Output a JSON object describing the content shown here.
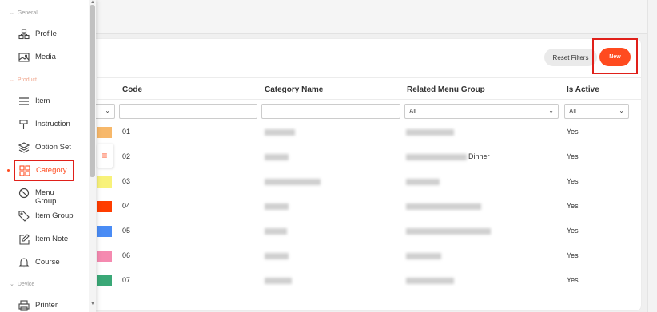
{
  "sidebar": {
    "sections": [
      {
        "label": "General"
      },
      {
        "label": "Product"
      },
      {
        "label": "Device"
      }
    ],
    "items": [
      {
        "label": "Profile",
        "icon": "profile-icon"
      },
      {
        "label": "Media",
        "icon": "image-icon"
      },
      {
        "label": "Item",
        "icon": "list-icon"
      },
      {
        "label": "Instruction",
        "icon": "instruction-icon"
      },
      {
        "label": "Option Set",
        "icon": "layers-icon"
      },
      {
        "label": "Category",
        "icon": "grid-icon",
        "active": true
      },
      {
        "label": "Menu Group",
        "icon": "no-entry-icon"
      },
      {
        "label": "Item Group",
        "icon": "tag-icon"
      },
      {
        "label": "Item Note",
        "icon": "edit-icon"
      },
      {
        "label": "Course",
        "icon": "bell-icon"
      },
      {
        "label": "Printer",
        "icon": "printer-icon"
      }
    ]
  },
  "toolbar": {
    "reset_label": "Reset Filters",
    "new_label": "New"
  },
  "table": {
    "headers": {
      "code": "Code",
      "category_name": "Category Name",
      "related_menu_group": "Related Menu Group",
      "is_active": "Is Active"
    },
    "filters": {
      "related_menu_group": "All",
      "is_active": "All"
    },
    "rows": [
      {
        "color": "#f7b86a",
        "code": "01",
        "menu_group": "",
        "active": "Yes"
      },
      {
        "color": "#ffffff",
        "code": "02",
        "menu_group": "Dinner",
        "active": "Yes"
      },
      {
        "color": "#f8f27a",
        "code": "03",
        "menu_group": "",
        "active": "Yes"
      },
      {
        "color": "#ff3d00",
        "code": "04",
        "menu_group": "",
        "active": "Yes"
      },
      {
        "color": "#4a8cf5",
        "code": "05",
        "menu_group": "",
        "active": "Yes"
      },
      {
        "color": "#f58ab0",
        "code": "06",
        "menu_group": "",
        "active": "Yes"
      },
      {
        "color": "#3aa877",
        "code": "07",
        "menu_group": "",
        "active": "Yes"
      }
    ]
  },
  "colors": {
    "accent": "#ff4b1f",
    "highlight": "#e0201a"
  }
}
